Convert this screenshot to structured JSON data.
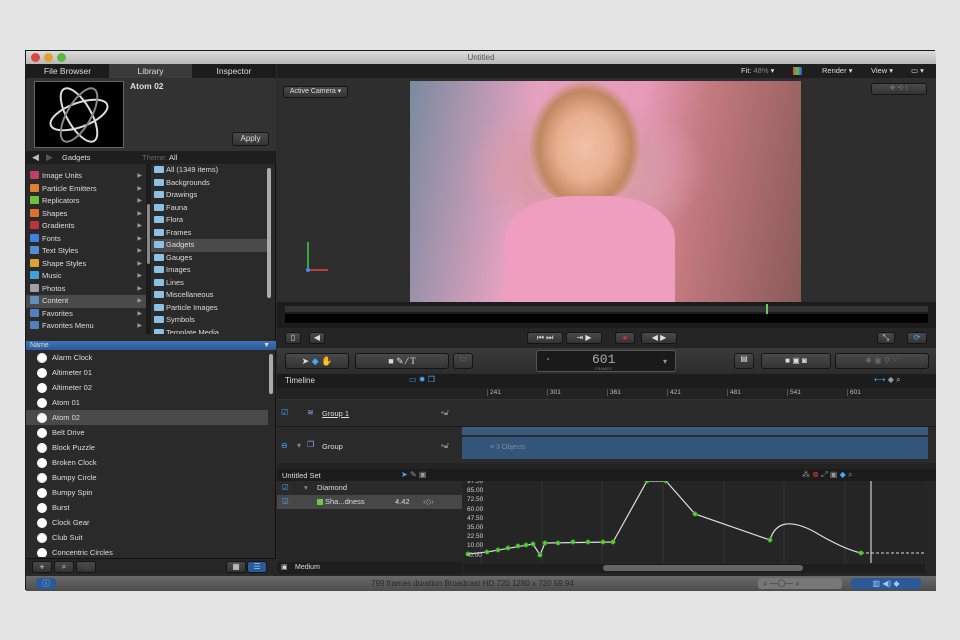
{
  "window": {
    "title": "Untitled"
  },
  "left_panel": {
    "tabs": [
      "File Browser",
      "Library",
      "Inspector"
    ],
    "preview_title": "Atom 02",
    "apply": "Apply",
    "nav": {
      "category": "Gadgets",
      "theme_label": "Theme:",
      "theme_value": "All"
    },
    "categories": [
      {
        "label": "Image Units",
        "color": "#c04060"
      },
      {
        "label": "Particle Emitters",
        "color": "#e08030"
      },
      {
        "label": "Replicators",
        "color": "#70c040"
      },
      {
        "label": "Shapes",
        "color": "#e07030"
      },
      {
        "label": "Gradients",
        "color": "#c03040"
      },
      {
        "label": "Fonts",
        "color": "#4080e0"
      },
      {
        "label": "Text Styles",
        "color": "#5090d0"
      },
      {
        "label": "Shape Styles",
        "color": "#e0a030"
      },
      {
        "label": "Music",
        "color": "#40a0e0"
      },
      {
        "label": "Photos",
        "color": "#a0a0a0"
      },
      {
        "label": "Content",
        "color": "#6090c0"
      },
      {
        "label": "Favorites",
        "color": "#5080c0"
      },
      {
        "label": "Favorites Menu",
        "color": "#5080c0"
      }
    ],
    "folders": [
      "All (1349 items)",
      "Backgrounds",
      "Drawings",
      "Fauna",
      "Flora",
      "Frames",
      "Gadgets",
      "Gauges",
      "Images",
      "Lines",
      "Miscellaneous",
      "Particle Images",
      "Symbols",
      "Template Media"
    ],
    "name_header": "Name",
    "items": [
      "Alarm Clock",
      "Altimeter 01",
      "Altimeter 02",
      "Atom 01",
      "Atom 02",
      "Belt Drive",
      "Block Puzzle",
      "Broken Clock",
      "Bumpy Circle",
      "Bumpy Spin",
      "Burst",
      "Clock Gear",
      "Club Suit",
      "Concentric Circles"
    ],
    "selected_item": "Atom 02"
  },
  "canvas": {
    "fit_label": "Fit:",
    "fit_value": "48%",
    "render": "Render",
    "view": "View",
    "camera": "Active Camera"
  },
  "toolbar": {
    "frame_value": "601",
    "frame_unit": "FRAMES"
  },
  "timeline": {
    "title": "Timeline",
    "ruler": [
      "241",
      "301",
      "361",
      "421",
      "481",
      "541",
      "601"
    ],
    "rows": [
      {
        "name": "Group 1"
      },
      {
        "name": "Group"
      }
    ],
    "bar_label": "3 Objects"
  },
  "keyframes": {
    "set": "Untitled Set",
    "object": "Diamond",
    "param": "Sha...dness",
    "param_value": "4.42",
    "y_labels": [
      "97.50",
      "85.00",
      "72.50",
      "60.00",
      "47.50",
      "35.00",
      "22.50",
      "10.00",
      "-0.00"
    ],
    "zoom_mode": "Medium"
  },
  "status": {
    "text": "799 frames duration Broadcast HD 720 1280 x 720 59.94"
  }
}
